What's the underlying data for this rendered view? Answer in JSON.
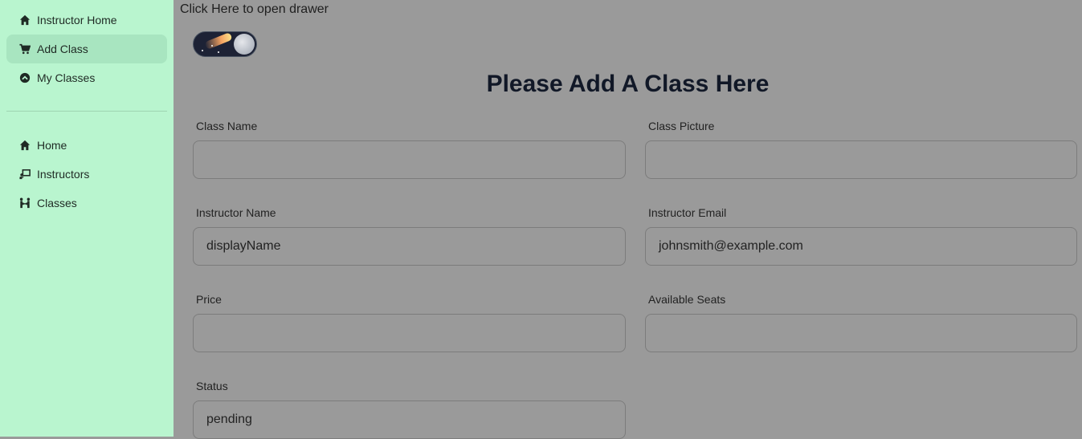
{
  "sidebar": {
    "top_items": [
      {
        "label": "Instructor Home",
        "icon": "home-icon"
      },
      {
        "label": "Add Class",
        "icon": "cart-icon",
        "active": true
      },
      {
        "label": "My Classes",
        "icon": "chevron-up-circle-icon"
      }
    ],
    "bottom_items": [
      {
        "label": "Home",
        "icon": "home-icon"
      },
      {
        "label": "Instructors",
        "icon": "chalkboard-teacher-icon"
      },
      {
        "label": "Classes",
        "icon": "people-arrows-icon"
      }
    ]
  },
  "main": {
    "drawer_link": "Click Here to open drawer",
    "title": "Please Add A Class Here",
    "form": {
      "class_name": {
        "label": "Class Name",
        "value": ""
      },
      "class_picture": {
        "label": "Class Picture",
        "value": ""
      },
      "instructor_name": {
        "label": "Instructor Name",
        "value": "displayName"
      },
      "instructor_email": {
        "label": "Instructor Email",
        "value": "johnsmith@example.com"
      },
      "price": {
        "label": "Price",
        "value": ""
      },
      "available_seats": {
        "label": "Available Seats",
        "value": ""
      },
      "status": {
        "label": "Status",
        "value": "pending"
      }
    }
  },
  "colors": {
    "sidebar_bg": "#b9f5cf",
    "active_item_bg": "#a8e5c0",
    "main_bg": "#9a9a9a"
  }
}
